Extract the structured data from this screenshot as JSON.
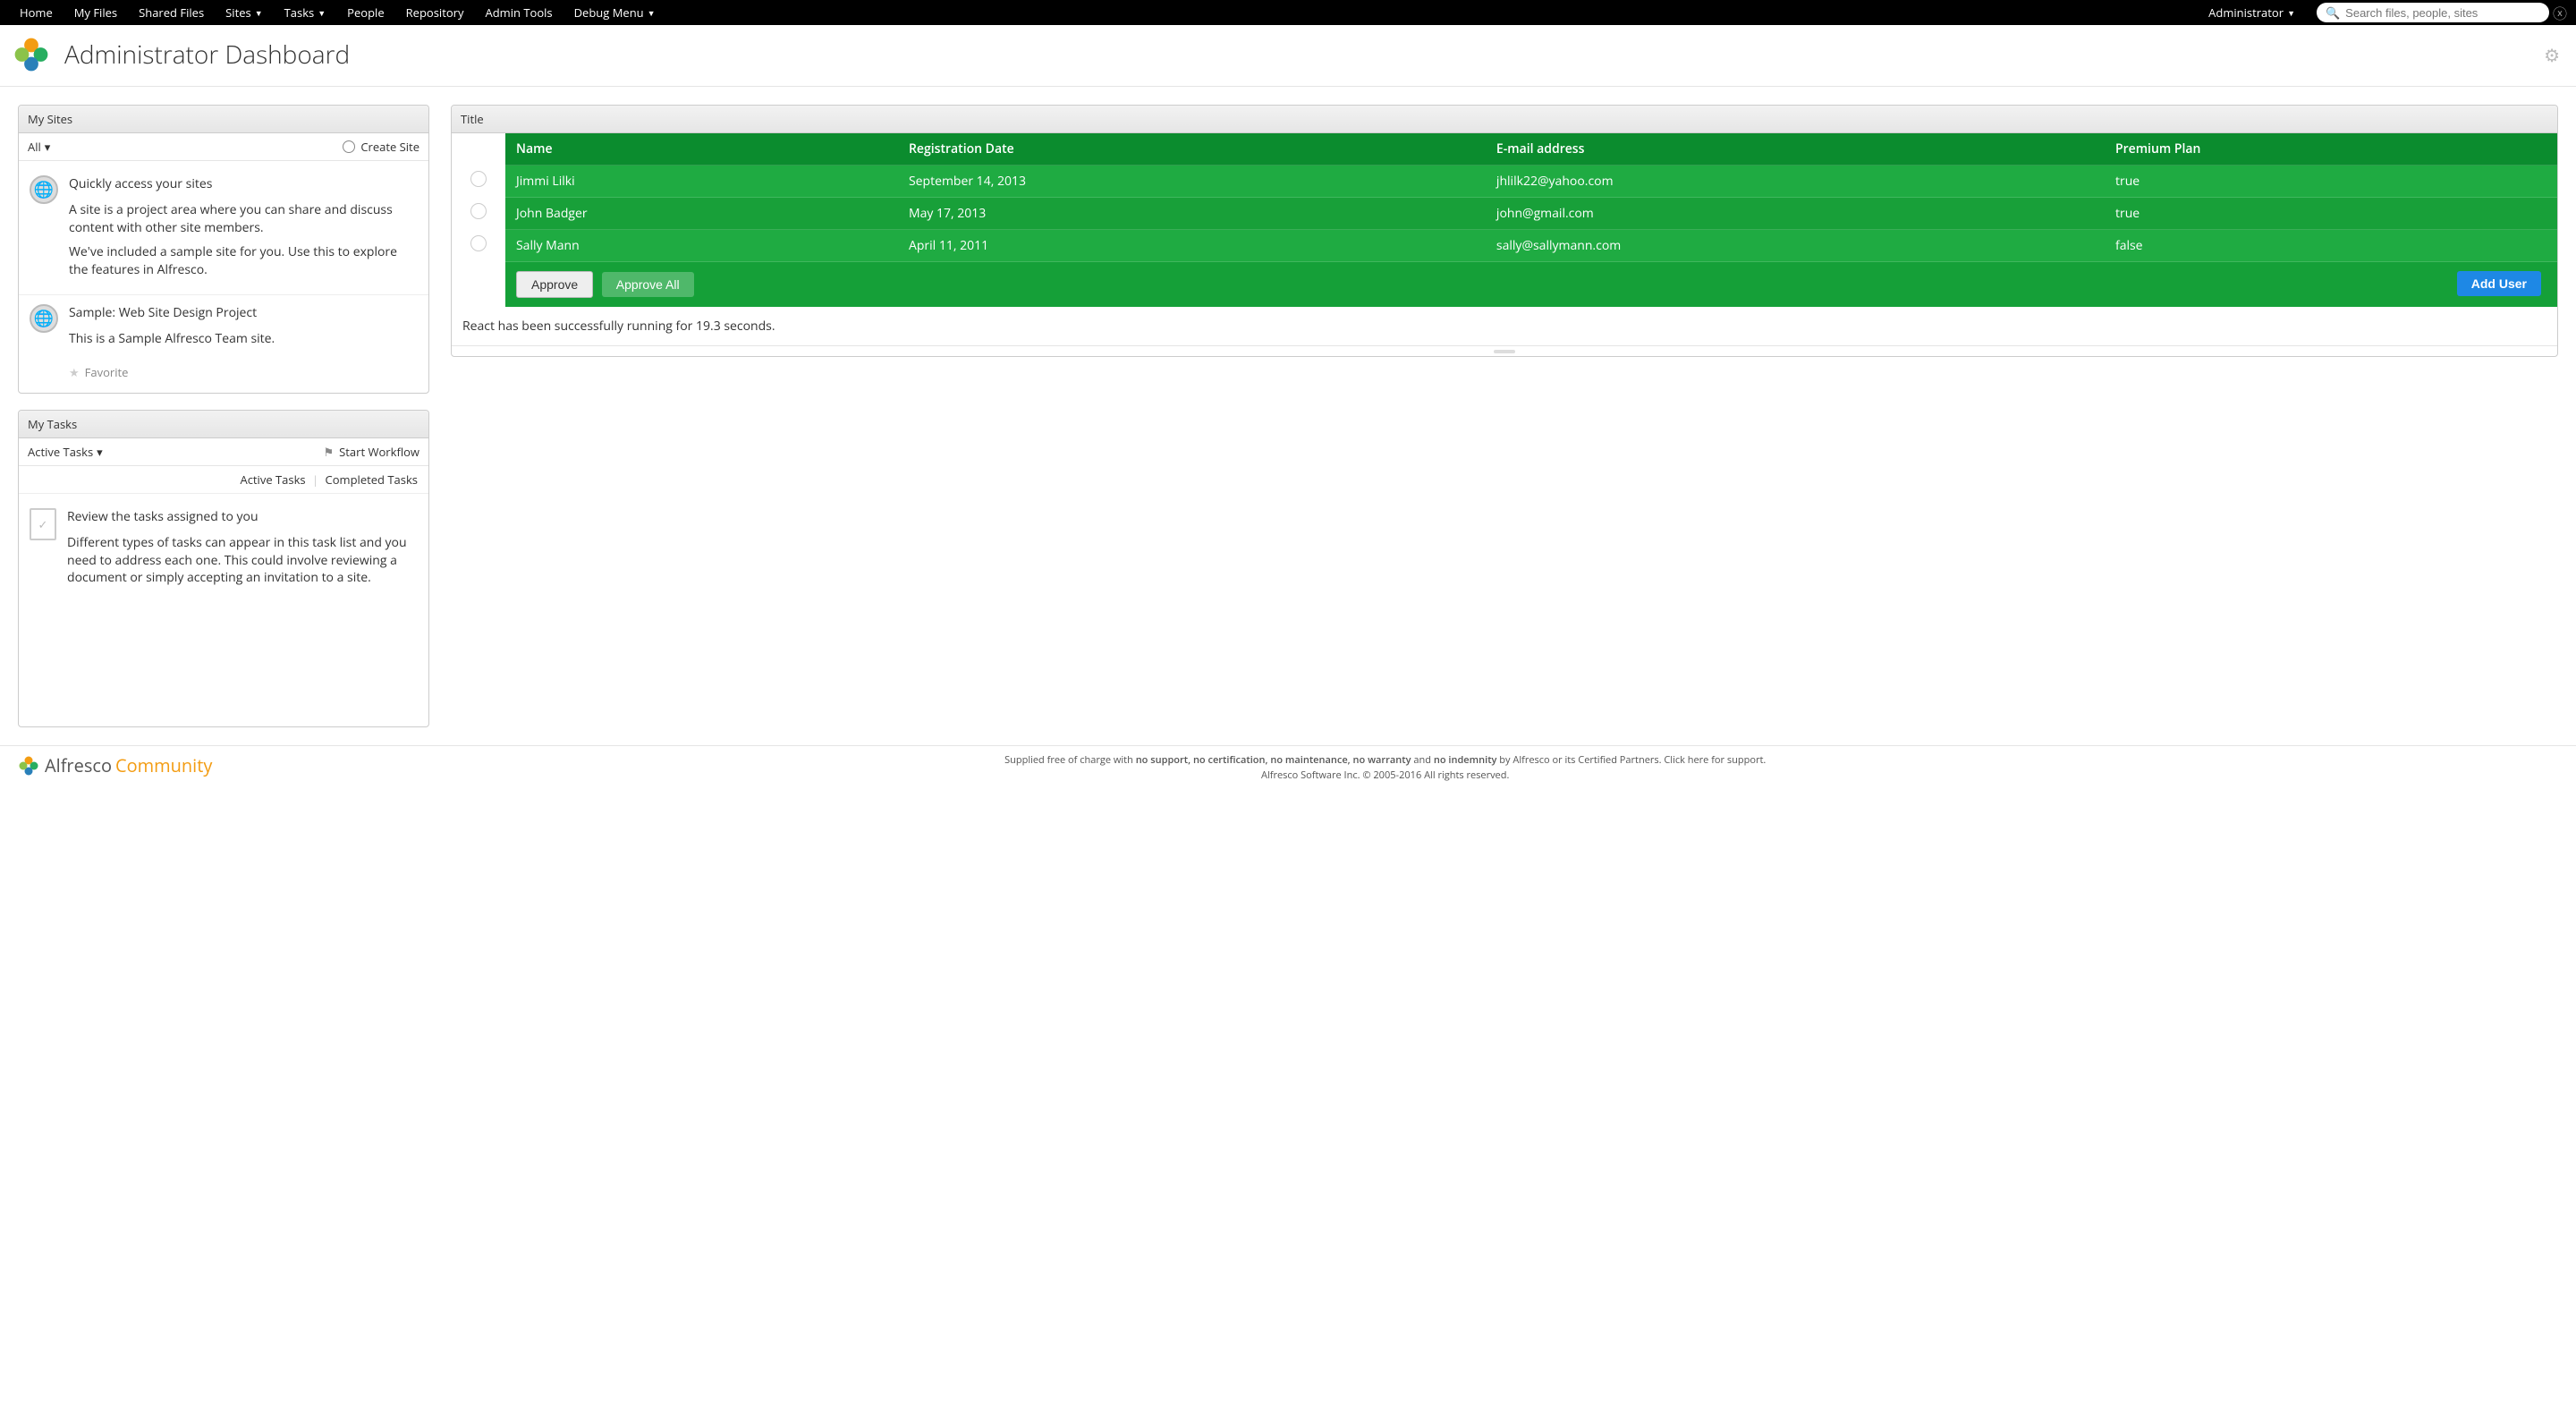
{
  "nav": {
    "items": [
      "Home",
      "My Files",
      "Shared Files",
      "Sites",
      "Tasks",
      "People",
      "Repository",
      "Admin Tools",
      "Debug Menu"
    ],
    "dropdowns": [
      false,
      false,
      false,
      true,
      true,
      false,
      false,
      false,
      true
    ],
    "user": "Administrator"
  },
  "search": {
    "placeholder": "Search files, people, sites"
  },
  "header": {
    "title": "Administrator Dashboard"
  },
  "mysites": {
    "title": "My Sites",
    "filter": "All",
    "create": "Create Site",
    "intro_title": "Quickly access your sites",
    "intro_p1": "A site is a project area where you can share and discuss content with other site members.",
    "intro_p2": "We've included a sample site for you. Use this to explore the features in Alfresco.",
    "sample_title": "Sample: Web Site Design Project",
    "sample_desc": "This is a Sample Alfresco Team site.",
    "favorite": "Favorite"
  },
  "mytasks": {
    "title": "My Tasks",
    "filter": "Active Tasks",
    "start": "Start Workflow",
    "tab_active": "Active Tasks",
    "tab_completed": "Completed Tasks",
    "intro_title": "Review the tasks assigned to you",
    "intro_body": "Different types of tasks can appear in this task list and you need to address each one. This could involve reviewing a document or simply accepting an invitation to a site."
  },
  "rightpanel": {
    "title": "Title",
    "columns": [
      "Name",
      "Registration Date",
      "E-mail address",
      "Premium Plan"
    ],
    "rows": [
      {
        "name": "Jimmi Lilki",
        "date": "September 14, 2013",
        "email": "jhlilk22@yahoo.com",
        "premium": "true"
      },
      {
        "name": "John Badger",
        "date": "May 17, 2013",
        "email": "john@gmail.com",
        "premium": "true"
      },
      {
        "name": "Sally Mann",
        "date": "April 11, 2011",
        "email": "sally@sallymann.com",
        "premium": "false"
      }
    ],
    "approve": "Approve",
    "approve_all": "Approve All",
    "add_user": "Add User",
    "status": "React has been successfully running for 19.3 seconds."
  },
  "footer": {
    "line1_pre": "Supplied free of charge with ",
    "line1_b1": "no support, no certification, no maintenance, no warranty",
    "line1_mid": " and ",
    "line1_b2": "no indemnity",
    "line1_post1": " by ",
    "line1_link1": "Alfresco",
    "line1_post2": " or its ",
    "line1_link2": "Certified Partners",
    "line1_post3": ". Click here for support.",
    "line2": "Alfresco Software Inc. © 2005-2016 All rights reserved.",
    "brand1": "Alfresco",
    "brand2": "Community"
  }
}
